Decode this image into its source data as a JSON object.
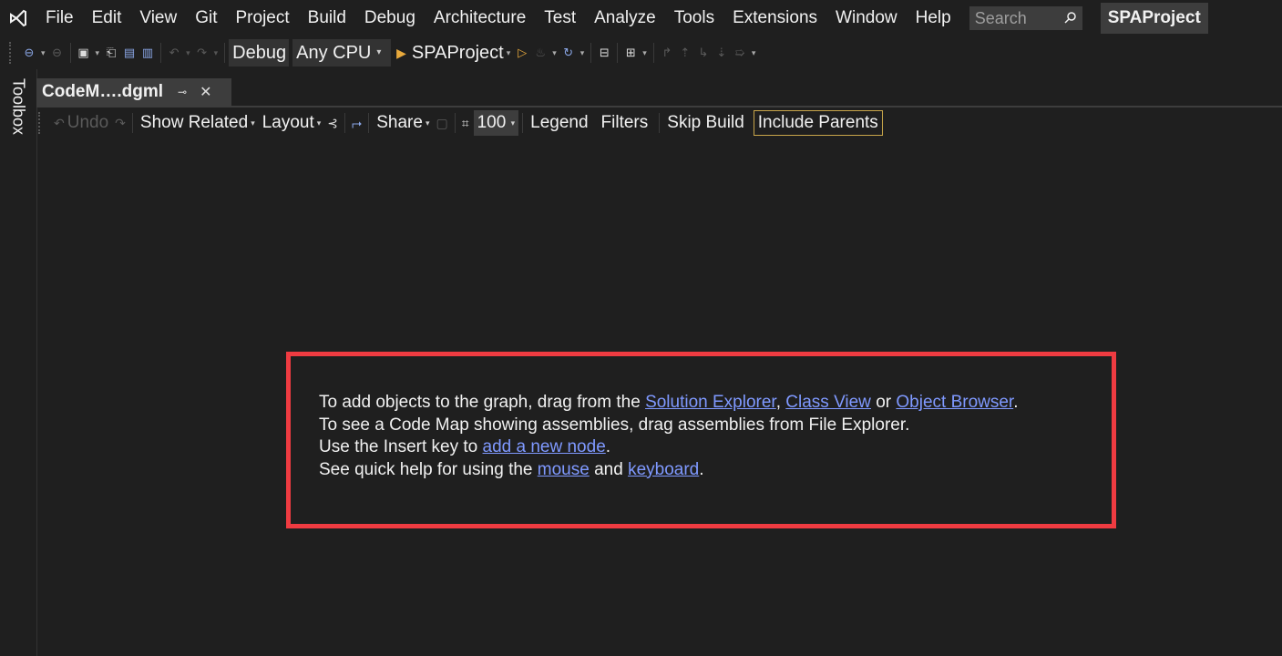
{
  "menubar": {
    "items": [
      "File",
      "Edit",
      "View",
      "Git",
      "Project",
      "Build",
      "Debug",
      "Architecture",
      "Test",
      "Analyze",
      "Tools",
      "Extensions",
      "Window",
      "Help"
    ],
    "search_placeholder": "Search",
    "project_name": "SPAProject"
  },
  "toolbar": {
    "config_combo": "Debug",
    "platform_combo": "Any CPU",
    "run_target": "SPAProject"
  },
  "left_panel": {
    "toolbox_label": "Toolbox"
  },
  "document_tab": {
    "title": "CodeM….dgml"
  },
  "codemap_toolbar": {
    "undo": "Undo",
    "show_related": "Show Related",
    "layout": "Layout",
    "share": "Share",
    "zoom": "100",
    "legend": "Legend",
    "filters": "Filters",
    "skip_build": "Skip Build",
    "include_parents": "Include Parents"
  },
  "help": {
    "line1_prefix": "To add objects to the graph, drag from the ",
    "link_solution_explorer": "Solution Explorer",
    "comma": ",",
    "link_class_view": "Class View",
    "or": " or ",
    "link_object_browser": "Object Browser",
    "period": ".",
    "line2": "To see a Code Map showing assemblies, drag assemblies from File Explorer.",
    "line3_prefix": "Use the Insert key to ",
    "link_add_node": "add a new node",
    "line4_prefix": "See quick help for using the ",
    "link_mouse": "mouse",
    "and": " and ",
    "link_keyboard": "keyboard"
  },
  "colors": {
    "background": "#1f1f1f",
    "highlight_border": "#ef3b41",
    "link": "#7f99ff",
    "include_parents_border": "#c8a64a"
  }
}
